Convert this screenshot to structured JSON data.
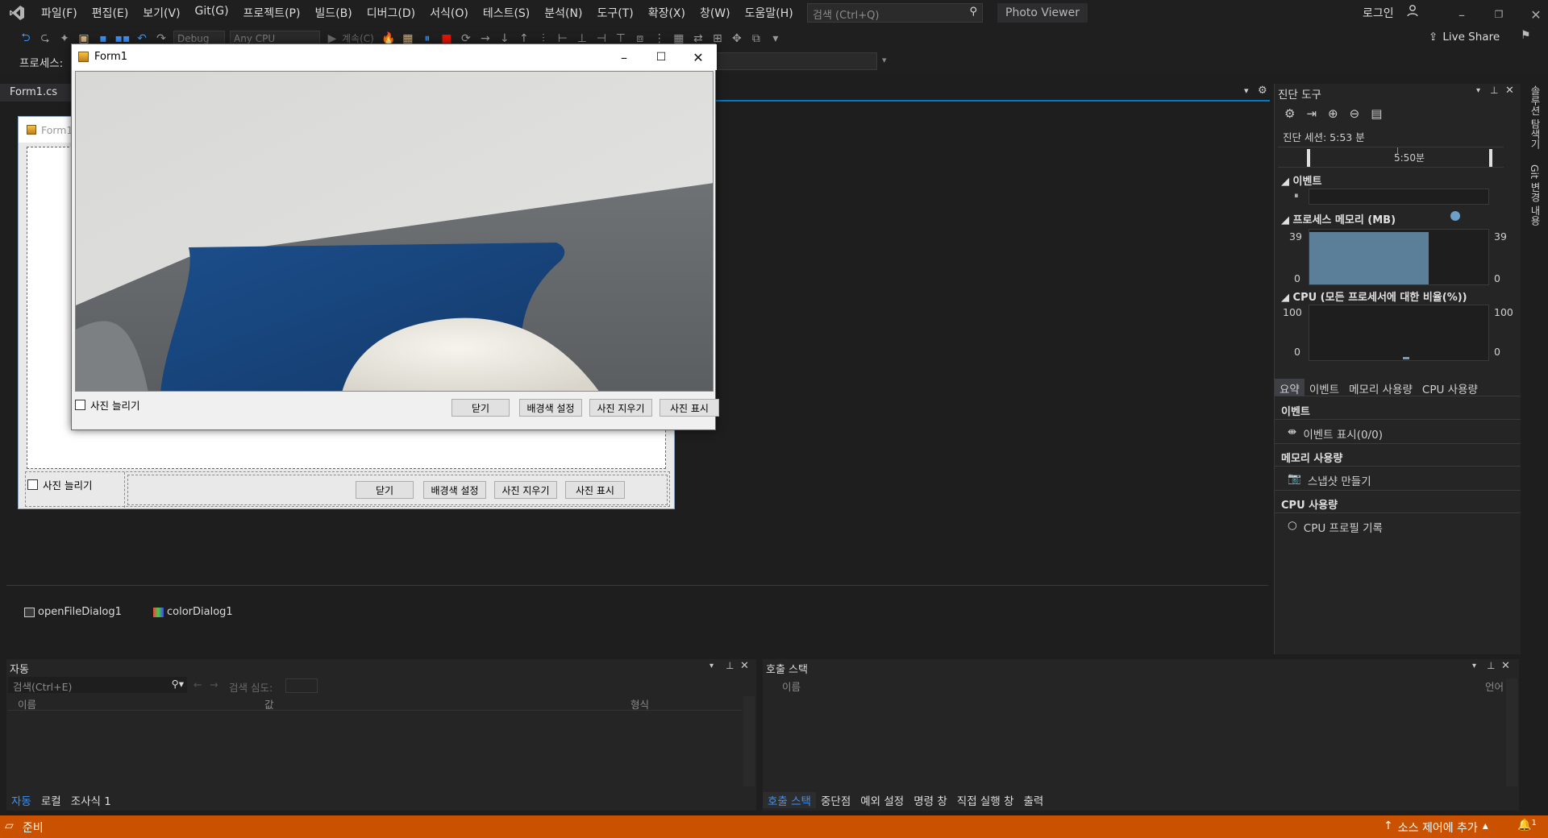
{
  "app": {
    "menu": [
      "파일(F)",
      "편집(E)",
      "보기(V)",
      "Git(G)",
      "프로젝트(P)",
      "빌드(B)",
      "디버그(D)",
      "서식(O)",
      "테스트(S)",
      "분석(N)",
      "도구(T)",
      "확장(X)",
      "창(W)",
      "도움말(H)"
    ],
    "search_placeholder": "검색 (Ctrl+Q)",
    "solution_name": "Photo Viewer",
    "login": "로그인",
    "live_share": "Live Share",
    "config": "Debug",
    "platform": "Any CPU",
    "continue_label": "계속(C)",
    "process_label": "프로세스:"
  },
  "editor": {
    "doc_tab": "Form1.cs",
    "designer_form_title": "Form1",
    "designer_checkbox": "사진 늘리기",
    "designer_buttons": [
      "닫기",
      "배경색 설정",
      "사진 지우기",
      "사진 표시"
    ],
    "tray": [
      "openFileDialog1",
      "colorDialog1"
    ]
  },
  "running_form": {
    "title": "Form1",
    "checkbox": "사진 늘리기",
    "buttons": [
      "닫기",
      "배경색 설정",
      "사진 지우기",
      "사진 표시"
    ]
  },
  "diagnostics": {
    "title": "진단 도구",
    "session": "진단 세션: 5:53 분",
    "timeline_label": "5:50분",
    "events_header": "이벤트",
    "memory_header": "프로세스 메모리 (MB)",
    "memory_max": "39",
    "memory_min": "0",
    "memory_level": 0.95,
    "cpu_header": "CPU (모든 프로세서에 대한 비율(%))",
    "cpu_max": "100",
    "cpu_min": "0",
    "tabs": [
      "요약",
      "이벤트",
      "메모리 사용량",
      "CPU 사용량"
    ],
    "sections": {
      "events": "이벤트",
      "show_events": "이벤트 표시(0/0)",
      "memory": "메모리 사용량",
      "snapshot": "스냅샷 만들기",
      "cpu": "CPU 사용량",
      "cpu_profile": "CPU 프로필 기록"
    },
    "right_rail": [
      "솔루션 탐색기",
      "Git 변경 내용"
    ]
  },
  "autos": {
    "title": "자동",
    "search": "검색(Ctrl+E)",
    "depth": "검색 심도:",
    "cols": [
      "이름",
      "값",
      "형식"
    ],
    "tabs": [
      "자동",
      "로컬",
      "조사식 1"
    ]
  },
  "callstack": {
    "title": "호출 스택",
    "cols": [
      "이름",
      "언어"
    ],
    "tabs": [
      "호출 스택",
      "중단점",
      "예외 설정",
      "명령 창",
      "직접 실행 창",
      "출력"
    ]
  },
  "status": {
    "ready": "준비",
    "source_control": "소스 제어에 추가",
    "notif_count": "1"
  },
  "colors": {
    "accent": "#007acc",
    "status_bg": "#ca5100",
    "memory_bar": "#5b7f99"
  }
}
